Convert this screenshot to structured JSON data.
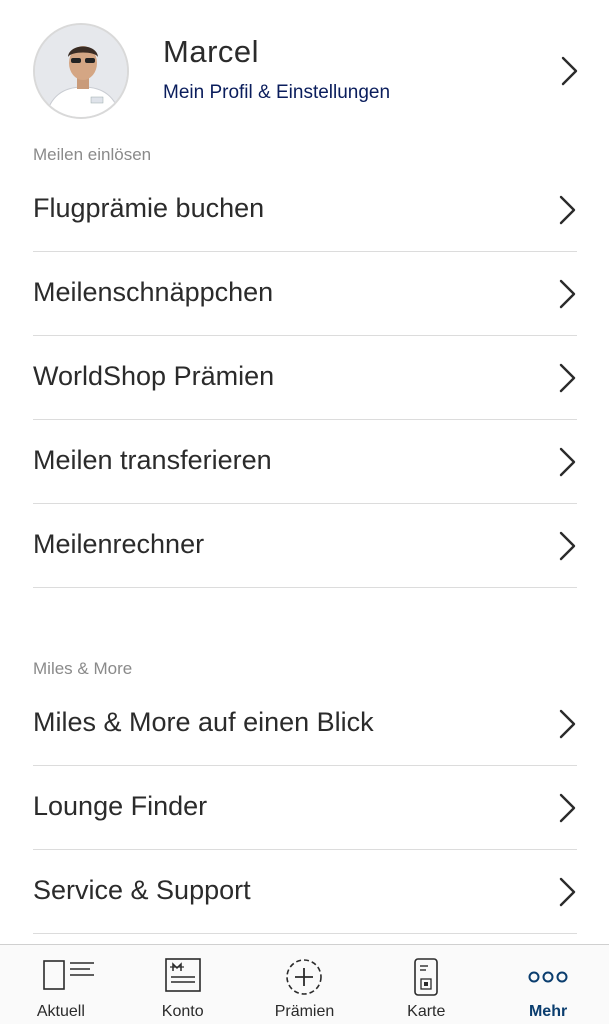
{
  "profile": {
    "name": "Marcel",
    "subtitle": "Mein Profil & Einstellungen"
  },
  "sections": [
    {
      "label": "Meilen einlösen",
      "items": [
        {
          "label": "Flugprämie buchen"
        },
        {
          "label": "Meilenschnäppchen"
        },
        {
          "label": "WorldShop Prämien"
        },
        {
          "label": "Meilen transferieren"
        },
        {
          "label": "Meilenrechner"
        }
      ]
    },
    {
      "label": "Miles & More",
      "items": [
        {
          "label": "Miles & More auf einen Blick"
        },
        {
          "label": "Lounge Finder"
        },
        {
          "label": "Service & Support"
        }
      ]
    }
  ],
  "tabbar": {
    "tabs": [
      {
        "label": "Aktuell",
        "icon": "news-icon"
      },
      {
        "label": "Konto",
        "icon": "account-statement-icon"
      },
      {
        "label": "Prämien",
        "icon": "plus-circle-icon"
      },
      {
        "label": "Karte",
        "icon": "card-icon"
      },
      {
        "label": "Mehr",
        "icon": "more-dots-icon",
        "active": true
      }
    ]
  },
  "colors": {
    "accent": "#0a3d6e",
    "link": "#0a1d5c",
    "section_label": "#8a8a8a",
    "divider": "#dcdcdc"
  }
}
